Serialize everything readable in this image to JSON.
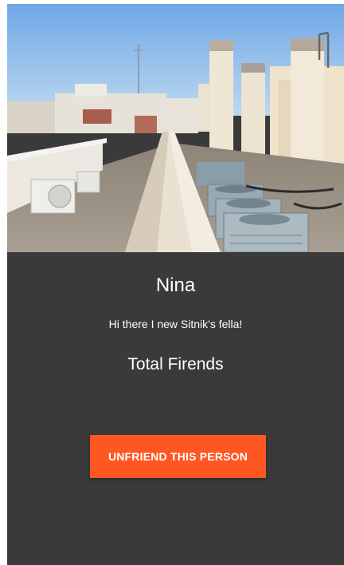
{
  "profile": {
    "name": "Nina",
    "bio": "Hi there I new Sitnik's fella!",
    "friends_label": "Total Firends"
  },
  "actions": {
    "unfriend_label": "UNFRIEND THIS PERSON"
  },
  "colors": {
    "background": "#3a3a3a",
    "accent": "#ff5722",
    "text": "#ffffff"
  }
}
